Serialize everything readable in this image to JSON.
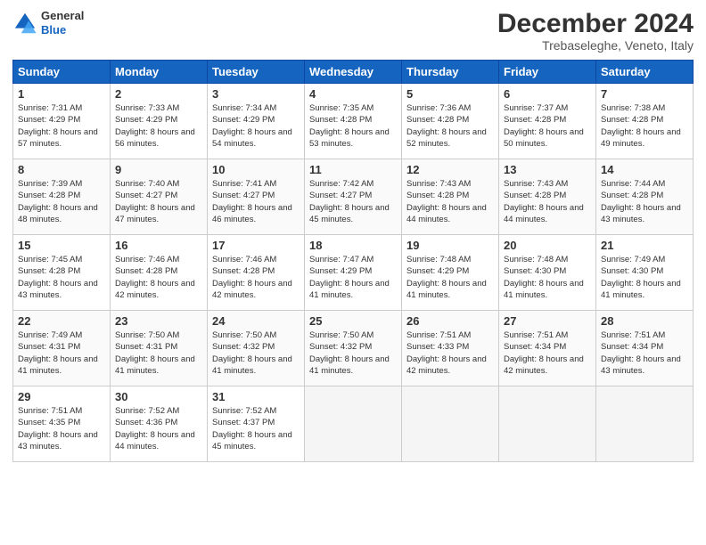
{
  "header": {
    "logo": {
      "general": "General",
      "blue": "Blue"
    },
    "title": "December 2024",
    "subtitle": "Trebaseleghe, Veneto, Italy"
  },
  "weekdays": [
    "Sunday",
    "Monday",
    "Tuesday",
    "Wednesday",
    "Thursday",
    "Friday",
    "Saturday"
  ],
  "weeks": [
    [
      {
        "day": 1,
        "sunrise": "7:31 AM",
        "sunset": "4:29 PM",
        "daylight": "8 hours and 57 minutes."
      },
      {
        "day": 2,
        "sunrise": "7:33 AM",
        "sunset": "4:29 PM",
        "daylight": "8 hours and 56 minutes."
      },
      {
        "day": 3,
        "sunrise": "7:34 AM",
        "sunset": "4:29 PM",
        "daylight": "8 hours and 54 minutes."
      },
      {
        "day": 4,
        "sunrise": "7:35 AM",
        "sunset": "4:28 PM",
        "daylight": "8 hours and 53 minutes."
      },
      {
        "day": 5,
        "sunrise": "7:36 AM",
        "sunset": "4:28 PM",
        "daylight": "8 hours and 52 minutes."
      },
      {
        "day": 6,
        "sunrise": "7:37 AM",
        "sunset": "4:28 PM",
        "daylight": "8 hours and 50 minutes."
      },
      {
        "day": 7,
        "sunrise": "7:38 AM",
        "sunset": "4:28 PM",
        "daylight": "8 hours and 49 minutes."
      }
    ],
    [
      {
        "day": 8,
        "sunrise": "7:39 AM",
        "sunset": "4:28 PM",
        "daylight": "8 hours and 48 minutes."
      },
      {
        "day": 9,
        "sunrise": "7:40 AM",
        "sunset": "4:27 PM",
        "daylight": "8 hours and 47 minutes."
      },
      {
        "day": 10,
        "sunrise": "7:41 AM",
        "sunset": "4:27 PM",
        "daylight": "8 hours and 46 minutes."
      },
      {
        "day": 11,
        "sunrise": "7:42 AM",
        "sunset": "4:27 PM",
        "daylight": "8 hours and 45 minutes."
      },
      {
        "day": 12,
        "sunrise": "7:43 AM",
        "sunset": "4:28 PM",
        "daylight": "8 hours and 44 minutes."
      },
      {
        "day": 13,
        "sunrise": "7:43 AM",
        "sunset": "4:28 PM",
        "daylight": "8 hours and 44 minutes."
      },
      {
        "day": 14,
        "sunrise": "7:44 AM",
        "sunset": "4:28 PM",
        "daylight": "8 hours and 43 minutes."
      }
    ],
    [
      {
        "day": 15,
        "sunrise": "7:45 AM",
        "sunset": "4:28 PM",
        "daylight": "8 hours and 43 minutes."
      },
      {
        "day": 16,
        "sunrise": "7:46 AM",
        "sunset": "4:28 PM",
        "daylight": "8 hours and 42 minutes."
      },
      {
        "day": 17,
        "sunrise": "7:46 AM",
        "sunset": "4:28 PM",
        "daylight": "8 hours and 42 minutes."
      },
      {
        "day": 18,
        "sunrise": "7:47 AM",
        "sunset": "4:29 PM",
        "daylight": "8 hours and 41 minutes."
      },
      {
        "day": 19,
        "sunrise": "7:48 AM",
        "sunset": "4:29 PM",
        "daylight": "8 hours and 41 minutes."
      },
      {
        "day": 20,
        "sunrise": "7:48 AM",
        "sunset": "4:30 PM",
        "daylight": "8 hours and 41 minutes."
      },
      {
        "day": 21,
        "sunrise": "7:49 AM",
        "sunset": "4:30 PM",
        "daylight": "8 hours and 41 minutes."
      }
    ],
    [
      {
        "day": 22,
        "sunrise": "7:49 AM",
        "sunset": "4:31 PM",
        "daylight": "8 hours and 41 minutes."
      },
      {
        "day": 23,
        "sunrise": "7:50 AM",
        "sunset": "4:31 PM",
        "daylight": "8 hours and 41 minutes."
      },
      {
        "day": 24,
        "sunrise": "7:50 AM",
        "sunset": "4:32 PM",
        "daylight": "8 hours and 41 minutes."
      },
      {
        "day": 25,
        "sunrise": "7:50 AM",
        "sunset": "4:32 PM",
        "daylight": "8 hours and 41 minutes."
      },
      {
        "day": 26,
        "sunrise": "7:51 AM",
        "sunset": "4:33 PM",
        "daylight": "8 hours and 42 minutes."
      },
      {
        "day": 27,
        "sunrise": "7:51 AM",
        "sunset": "4:34 PM",
        "daylight": "8 hours and 42 minutes."
      },
      {
        "day": 28,
        "sunrise": "7:51 AM",
        "sunset": "4:34 PM",
        "daylight": "8 hours and 43 minutes."
      }
    ],
    [
      {
        "day": 29,
        "sunrise": "7:51 AM",
        "sunset": "4:35 PM",
        "daylight": "8 hours and 43 minutes."
      },
      {
        "day": 30,
        "sunrise": "7:52 AM",
        "sunset": "4:36 PM",
        "daylight": "8 hours and 44 minutes."
      },
      {
        "day": 31,
        "sunrise": "7:52 AM",
        "sunset": "4:37 PM",
        "daylight": "8 hours and 45 minutes."
      },
      null,
      null,
      null,
      null
    ]
  ],
  "labels": {
    "sunrise": "Sunrise:",
    "sunset": "Sunset:",
    "daylight": "Daylight:"
  }
}
